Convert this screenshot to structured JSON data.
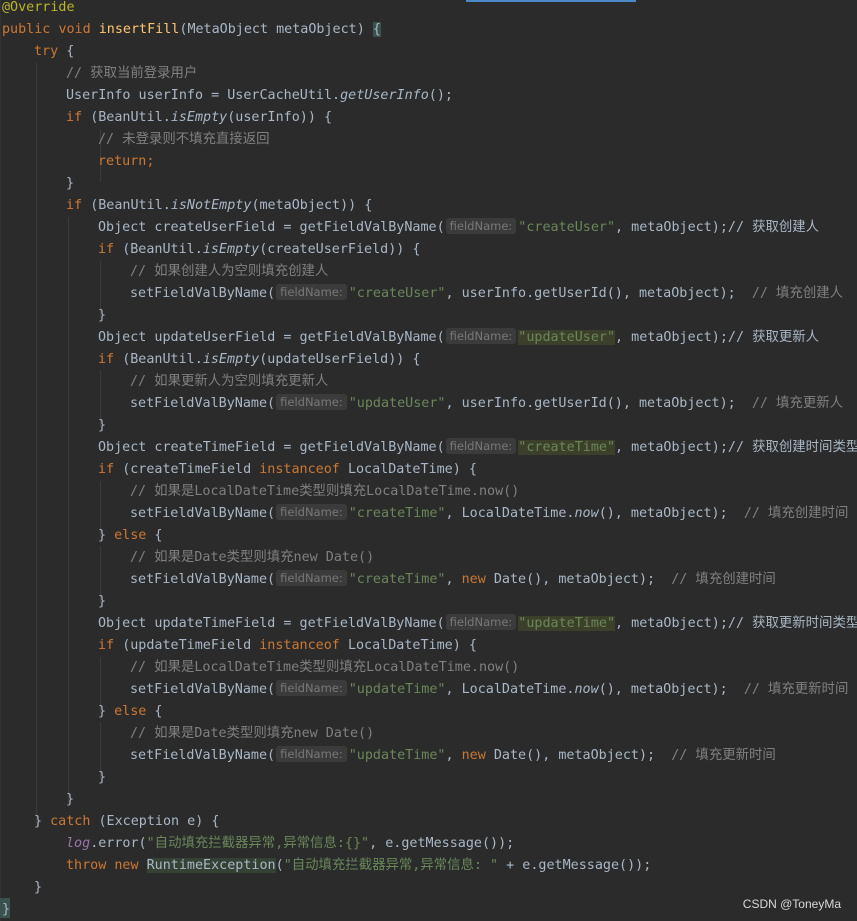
{
  "annotation": "@Override",
  "code": {
    "public": "public",
    "void": "void",
    "method_name": "insertFill",
    "param_type": "MetaObject",
    "param_name": "metaObject",
    "try": "try",
    "catch": "catch",
    "if": "if",
    "else": "else",
    "return": "return",
    "new": "new",
    "throw": "throw",
    "instanceof": "instanceof",
    "comment_get_user": "// 获取当前登录用户",
    "userinfo_decl_a": "UserInfo userInfo = UserCacheUtil.",
    "getUserInfo": "getUserInfo",
    "beanutil": "(BeanUtil.",
    "isEmpty": "isEmpty",
    "isNotEmpty": "isNotEmpty",
    "userInfo_arg": "(userInfo)) {",
    "comment_not_logged": "// 未登录则不填充直接返回",
    "metaObject_arg": "(metaObject)) {",
    "obj_create_user": "Object createUserField = getFieldValByName(",
    "obj_update_user": "Object updateUserField = getFieldValByName(",
    "obj_create_time": "Object createTimeField = getFieldValByName(",
    "obj_update_time": "Object updateTimeField = getFieldValByName(",
    "hint_fieldName": "fieldName:",
    "s_createUser": "\"createUser\"",
    "s_updateUser": "\"updateUser\"",
    "s_createTime": "\"createTime\"",
    "s_updateTime": "\"updateTime\"",
    "meta_end_cm_create_user": ", metaObject);// 获取创建人",
    "meta_end_cm_update_user": ", metaObject);// 获取更新人",
    "meta_end_cm_create_time": ", metaObject);// 获取创建时间类型",
    "meta_end_cm_update_time": ", metaObject);// 获取更新时间类型",
    "createUserField_arg": "(createUserField)) {",
    "updateUserField_arg": "(updateUserField)) {",
    "comment_create_user_empty": "// 如果创建人为空则填充创建人",
    "comment_update_user_empty": "// 如果更新人为空则填充更新人",
    "setField": "setFieldValByName(",
    "userid_meta": ", userInfo.getUserId(), metaObject);",
    "cm_fill_create_user": "// 填充创建人",
    "cm_fill_update_user": "// 填充更新人",
    "if_createTimeField": "(createTimeField ",
    "if_updateTimeField": "(updateTimeField ",
    "LocalDateTime_brace": "LocalDateTime) {",
    "comment_ldt": "// 如果是LocalDateTime类型则填充LocalDateTime.now()",
    "ldt_now_a": ", LocalDateTime.",
    "now": "now",
    "now_meta": "(), metaObject);",
    "cm_fill_create_time": "// 填充创建时间",
    "cm_fill_update_time": "// 填充更新时间",
    "comment_date": "// 如果是Date类型则填充new Date()",
    "new_date_meta": "Date(), metaObject);",
    "exception_e": "(Exception e) {",
    "log": "log",
    "error_a": ".error(",
    "error_str": "\"自动填充拦截器异常,异常信息:{}\"",
    "error_end": ", e.getMessage());",
    "RuntimeException": "RuntimeException",
    "rte_str": "\"自动填充拦截器异常,异常信息: \"",
    "rte_end": " + e.getMessage());"
  },
  "watermark": "CSDN @ToneyMa"
}
